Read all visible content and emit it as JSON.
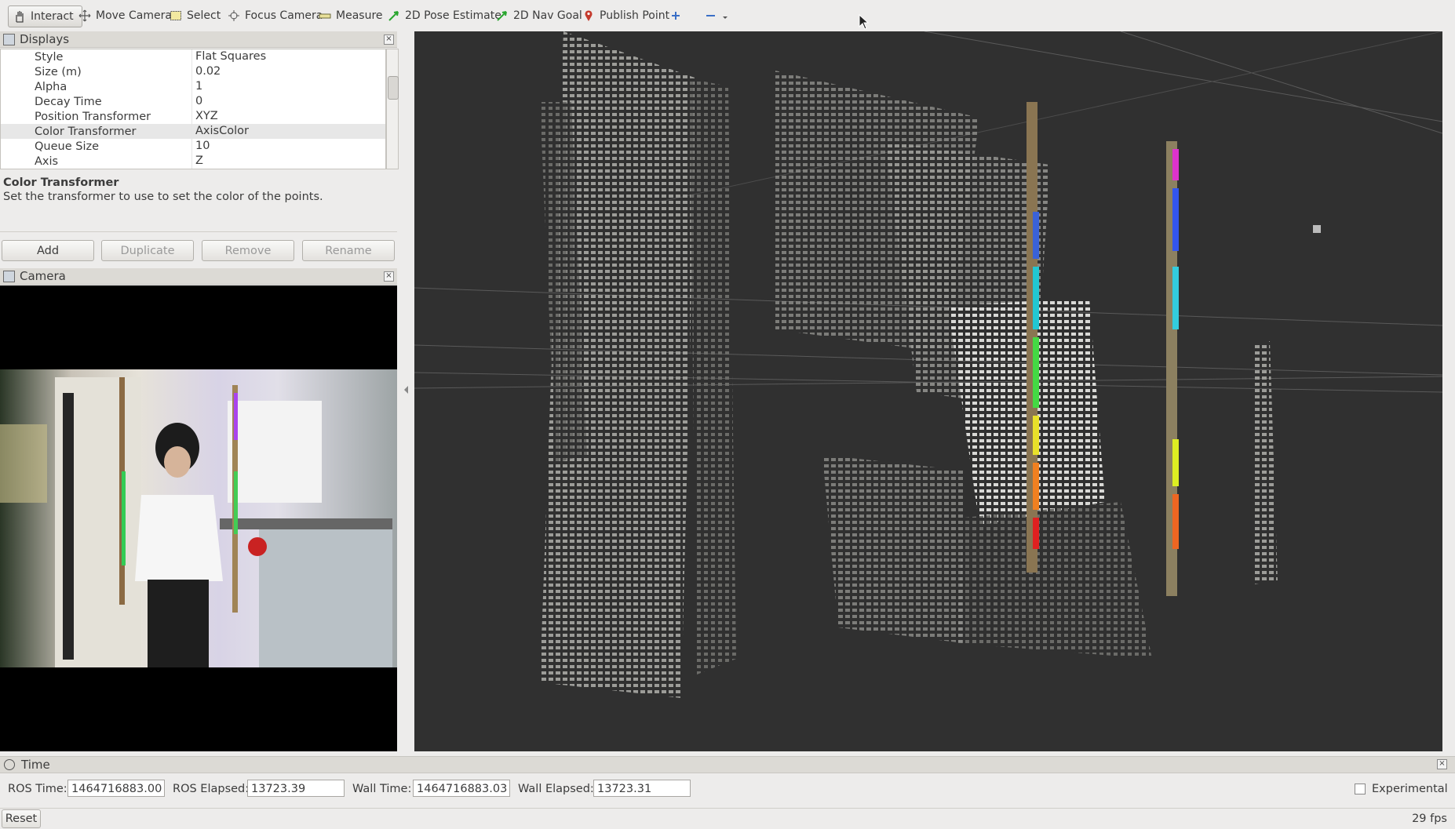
{
  "toolbar": {
    "tools": [
      {
        "label": "Interact",
        "icon": "hand-icon"
      },
      {
        "label": "Move Camera",
        "icon": "move-camera-icon"
      },
      {
        "label": "Select",
        "icon": "select-icon"
      },
      {
        "label": "Focus Camera",
        "icon": "focus-camera-icon"
      },
      {
        "label": "Measure",
        "icon": "ruler-icon"
      },
      {
        "label": "2D Pose Estimate",
        "icon": "green-arrow-icon"
      },
      {
        "label": "2D Nav Goal",
        "icon": "green-arrow-icon"
      },
      {
        "label": "Publish Point",
        "icon": "map-pin-icon"
      }
    ]
  },
  "displays": {
    "title": "Displays",
    "properties": [
      {
        "key": "Style",
        "value": "Flat Squares"
      },
      {
        "key": "Size (m)",
        "value": "0.02"
      },
      {
        "key": "Alpha",
        "value": "1"
      },
      {
        "key": "Decay Time",
        "value": "0"
      },
      {
        "key": "Position Transformer",
        "value": "XYZ"
      },
      {
        "key": "Color Transformer",
        "value": "AxisColor"
      },
      {
        "key": "Queue Size",
        "value": "10"
      },
      {
        "key": "Axis",
        "value": "Z"
      }
    ],
    "desc_title": "Color Transformer",
    "desc_text": "Set the transformer to use to set the color of the points.",
    "buttons": {
      "add": "Add",
      "duplicate": "Duplicate",
      "remove": "Remove",
      "rename": "Rename"
    }
  },
  "camera": {
    "title": "Camera"
  },
  "time": {
    "title": "Time",
    "ros_time_label": "ROS Time:",
    "ros_time": "1464716883.00",
    "ros_elapsed_label": "ROS Elapsed:",
    "ros_elapsed": "13723.39",
    "wall_time_label": "Wall Time:",
    "wall_time": "1464716883.03",
    "wall_elapsed_label": "Wall Elapsed:",
    "wall_elapsed": "13723.31",
    "experimental_label": "Experimental"
  },
  "status": {
    "reset": "Reset",
    "fps": "29 fps"
  }
}
